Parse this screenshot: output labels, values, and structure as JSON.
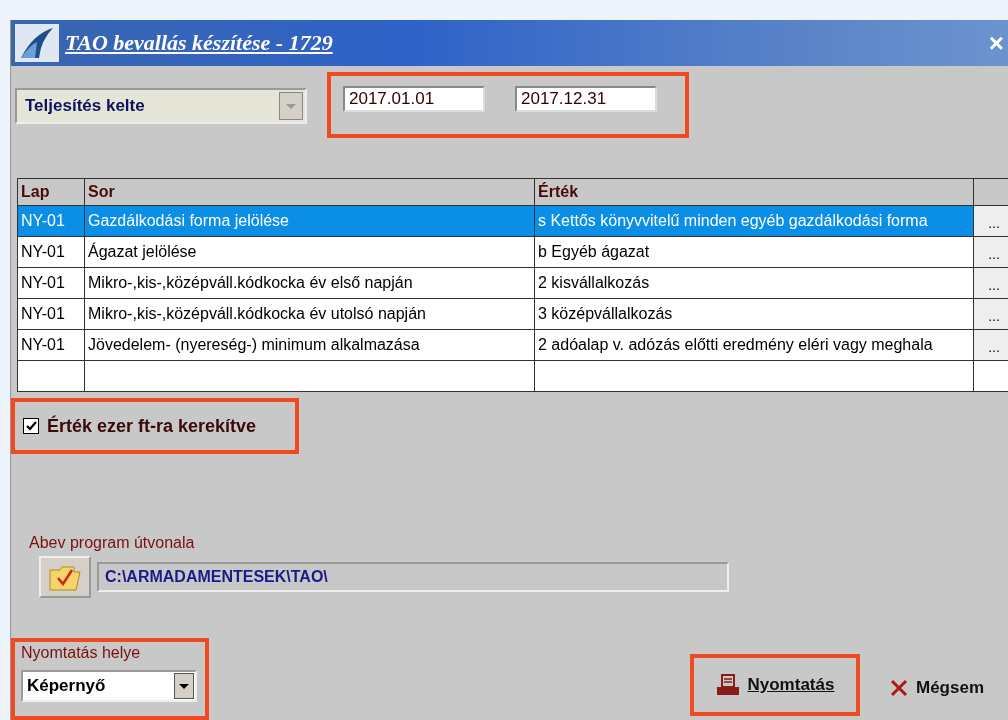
{
  "window": {
    "title": "TAO bevallás készítése - 1729",
    "close": "×"
  },
  "date_type": {
    "value": "Teljesítés kelte",
    "disabled": true
  },
  "date_from": "2017.01.01",
  "date_to": "2017.12.31",
  "table": {
    "columns": [
      "Lap",
      "Sor",
      "Érték"
    ],
    "rows": [
      {
        "lap": "NY-01",
        "sor": "Gazdálkodási forma jelölése",
        "ertek": "s Kettős könyvvitelű minden egyéb gazdálkodási forma",
        "action": "...",
        "selected": true
      },
      {
        "lap": "NY-01",
        "sor": "Ágazat jelölése",
        "ertek": "b Egyéb ágazat",
        "action": "...",
        "selected": false
      },
      {
        "lap": "NY-01",
        "sor": "Mikro-,kis-,középváll.kódkocka év első napján",
        "ertek": "2 kisvállalkozás",
        "action": "...",
        "selected": false
      },
      {
        "lap": "NY-01",
        "sor": "Mikro-,kis-,középváll.kódkocka év utolsó napján",
        "ertek": "3 középvállalkozás",
        "action": "...",
        "selected": false
      },
      {
        "lap": "NY-01",
        "sor": "Jövedelem- (nyereség-) minimum alkalmazása",
        "ertek": "2 adóalap v. adózás előtti eredmény eléri vagy meghala",
        "action": "...",
        "selected": false
      }
    ]
  },
  "rounding": {
    "label": "Érték ezer ft-ra kerekítve",
    "checked": true
  },
  "abev_path": {
    "label": "Abev program útvonala",
    "value": "C:\\ARMADAMENTESEK\\TAO\\"
  },
  "print_location": {
    "label": "Nyomtatás helye",
    "value": "Képernyő"
  },
  "buttons": [
    {
      "kind": "print",
      "label": "Nyomtatás"
    },
    {
      "kind": "cancel",
      "label": "Mégsem"
    }
  ]
}
